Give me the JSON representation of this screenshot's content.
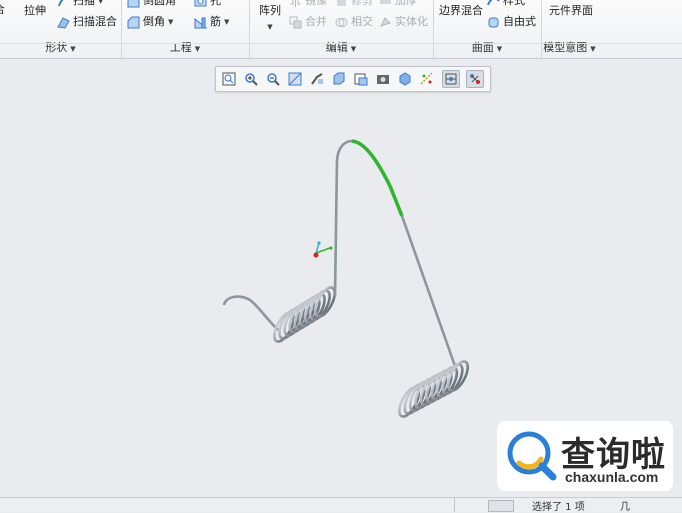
{
  "ribbon": {
    "shape": {
      "label": "形状",
      "buttons": {
        "partial_left": "合",
        "extrude": "拉伸",
        "sweep": "扫描",
        "swept_blend": "扫描混合"
      }
    },
    "engineering": {
      "label": "工程",
      "buttons": {
        "round": "倒圆角",
        "hole": "孔",
        "chamfer": "倒角",
        "rib": "筋"
      }
    },
    "editing": {
      "label": "编辑",
      "buttons": {
        "pattern": "阵列",
        "mirror": "镜像",
        "trim": "修剪",
        "thicken": "加厚",
        "merge": "合并",
        "intersect": "相交",
        "solidify": "实体化"
      }
    },
    "surfaces": {
      "label": "曲面",
      "buttons": {
        "boundary_blend": "边界混合",
        "style": "样式",
        "freestyle": "自由式"
      }
    },
    "model_intent": {
      "label": "模型意图",
      "buttons": {
        "component_interface": "元件界面"
      }
    }
  },
  "view_toolbar": {
    "icons": [
      "refit-icon",
      "zoom-in-icon",
      "zoom-out-icon",
      "repaint-icon",
      "view-manager-icon",
      "display-style-icon",
      "saved-views-icon",
      "named-view-icon",
      "perspective-icon",
      "datum-display-icon",
      "spin-center-icon",
      "annotation-display-icon"
    ]
  },
  "status_bar": {
    "selection_text": "选择了 1 项",
    "filter_text": "几"
  },
  "watermark": {
    "brand_cn": "查询啦",
    "brand_en": "chaxunla.com"
  },
  "colors": {
    "ribbon_bg": "#f3f4f6",
    "canvas_bg": "#e9ebee",
    "spring_wire": "#9aa1aa",
    "highlight": "#2fb52f",
    "watermark_blue": "#2a7fd8",
    "watermark_yellow": "#f2b51c"
  }
}
